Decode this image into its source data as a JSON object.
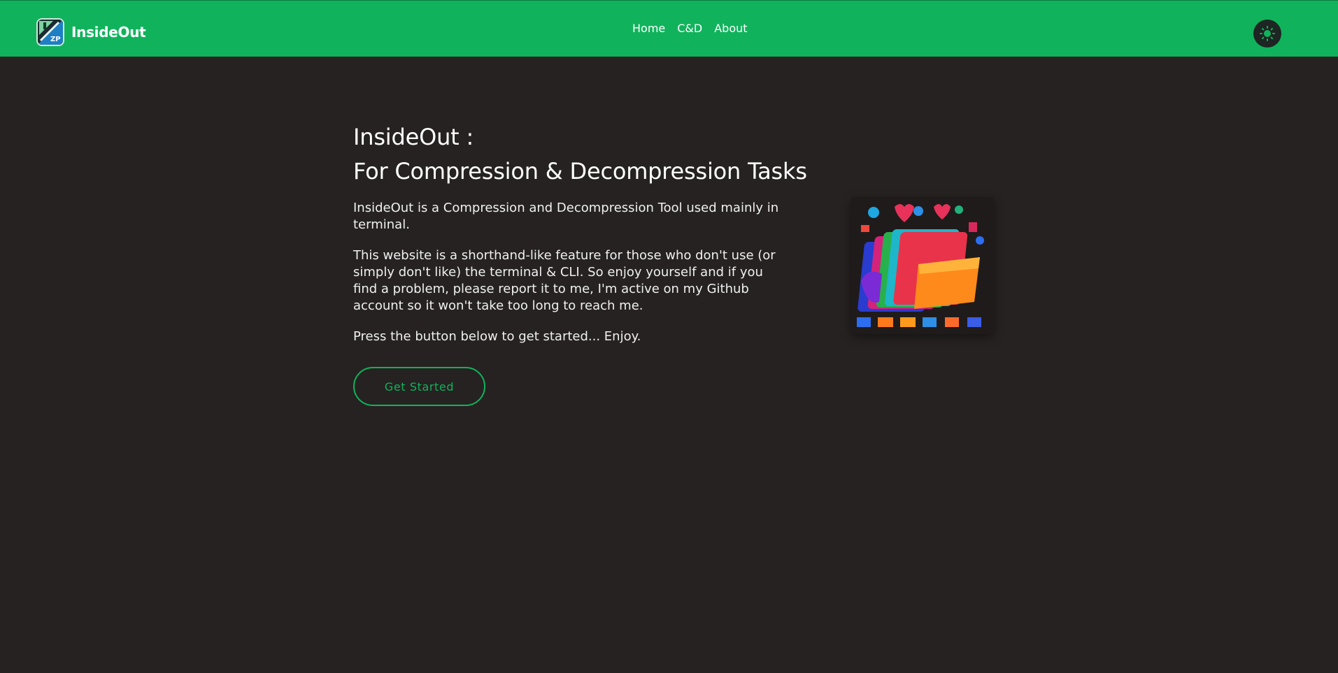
{
  "navbar": {
    "brand_name": "InsideOut",
    "logo_badge": "ZP",
    "links": [
      {
        "label": "Home"
      },
      {
        "label": "C&D"
      },
      {
        "label": "About"
      }
    ],
    "theme_toggle_icon": "sun-icon"
  },
  "hero": {
    "title_line1": "InsideOut :",
    "title_line2": "For Compression & Decompression Tasks",
    "paragraphs": [
      "InsideOut is a Compression and Decompression Tool used mainly in terminal.",
      "This website is a shorthand-like feature for those who don't use (or simply don't like) the terminal & CLI. So enjoy yourself and if you find a problem, please report it to me, I'm active on my Github account so it won't take too long to reach me.",
      "Press the button below to get started... Enjoy."
    ],
    "cta_label": "Get Started",
    "image_icon": "colorful-folders-illustration"
  },
  "colors": {
    "accent": "#10b35c",
    "background": "#262221",
    "text": "#ffffff"
  }
}
